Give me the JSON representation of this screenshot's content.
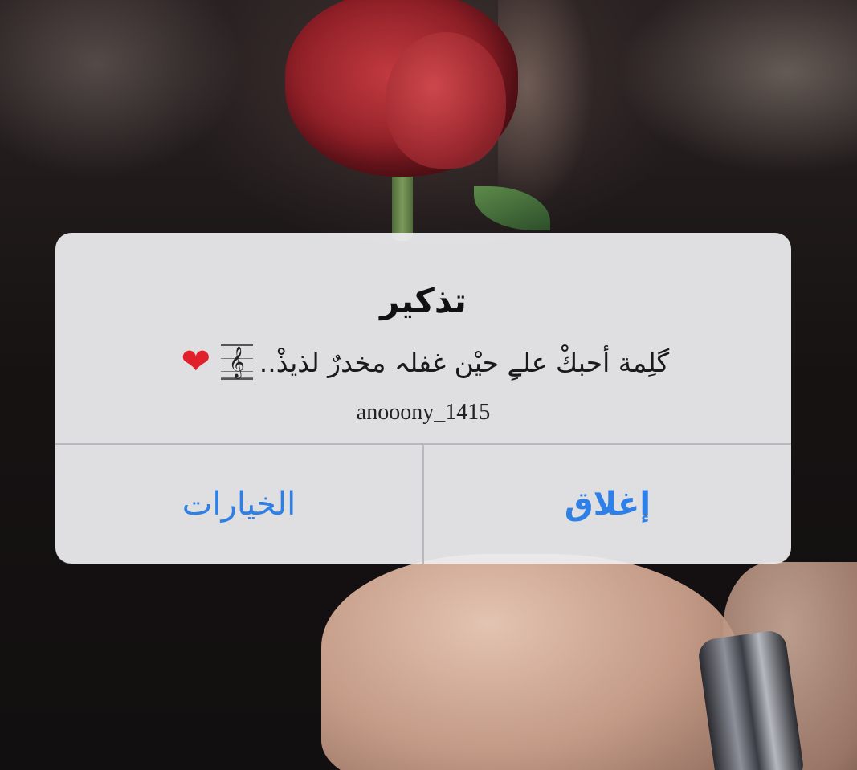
{
  "alert": {
    "title": "تذكير",
    "message": "گلِمة أحبكْ علےِ حيْن غفلہ مخدرٌ لذيذْ..",
    "signature": "anooony_1415",
    "buttons": {
      "options_label": "الخيارات",
      "close_label": "إغلاق"
    }
  },
  "icons": {
    "music": "treble-clef-icon",
    "heart": "red-heart-icon"
  },
  "colors": {
    "button_text": "#2f80e6",
    "dialog_bg": "#ececee",
    "heart": "#e0202b"
  }
}
